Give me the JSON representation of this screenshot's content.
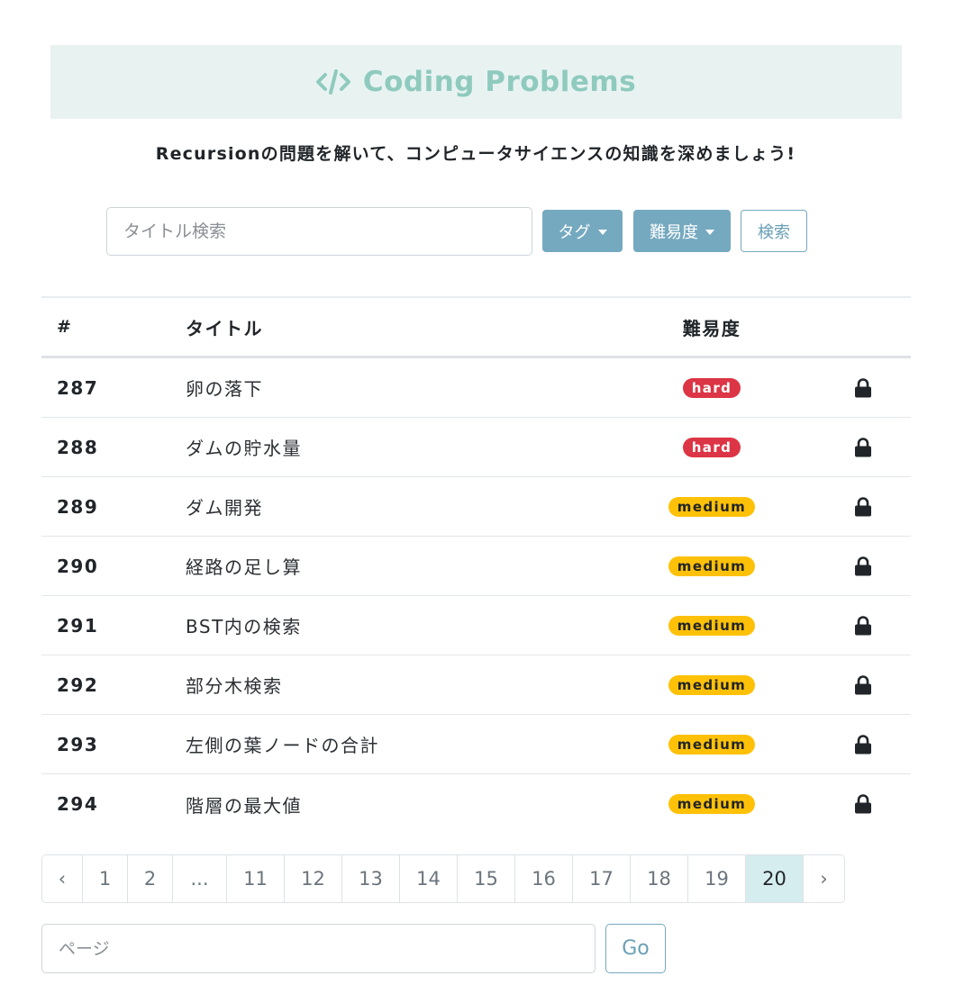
{
  "header": {
    "title": "Coding Problems",
    "title_color": "#8fcabe",
    "banner_bg": "#e8f3f1",
    "icon": "code-icon"
  },
  "subtitle": "Recursionの問題を解いて、コンピュータサイエンスの知識を深めましょう!",
  "search": {
    "placeholder": "タイトル検索",
    "tag_button": "タグ",
    "difficulty_button": "難易度",
    "search_button": "検索"
  },
  "table": {
    "headers": {
      "number": "#",
      "title": "タイトル",
      "difficulty": "難易度"
    },
    "rows": [
      {
        "number": "287",
        "title": "卵の落下",
        "difficulty": "hard",
        "icon": "lock-icon"
      },
      {
        "number": "288",
        "title": "ダムの貯水量",
        "difficulty": "hard",
        "icon": "lock-icon"
      },
      {
        "number": "289",
        "title": "ダム開発",
        "difficulty": "medium",
        "icon": "lock-icon"
      },
      {
        "number": "290",
        "title": "経路の足し算",
        "difficulty": "medium",
        "icon": "lock-icon"
      },
      {
        "number": "291",
        "title": "BST内の検索",
        "difficulty": "medium",
        "icon": "lock-icon"
      },
      {
        "number": "292",
        "title": "部分木検索",
        "difficulty": "medium",
        "icon": "lock-icon"
      },
      {
        "number": "293",
        "title": "左側の葉ノードの合計",
        "difficulty": "medium",
        "icon": "lock-icon"
      },
      {
        "number": "294",
        "title": "階層の最大値",
        "difficulty": "medium",
        "icon": "lock-icon"
      }
    ]
  },
  "colors": {
    "accent": "#75a9c0",
    "hard": "#dc3545",
    "medium": "#ffc107",
    "active_page": "#d6edf0"
  },
  "pagination": {
    "prev": "‹",
    "next": "›",
    "pages": [
      "1",
      "2",
      "...",
      "11",
      "12",
      "13",
      "14",
      "15",
      "16",
      "17",
      "18",
      "19",
      "20"
    ],
    "active": "20"
  },
  "page_jump": {
    "placeholder": "ページ",
    "go_button": "Go"
  }
}
